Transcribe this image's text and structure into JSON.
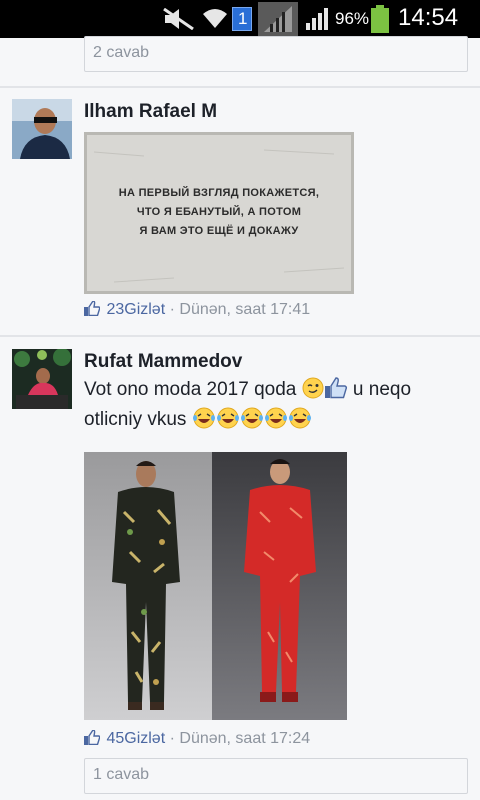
{
  "status_bar": {
    "notification_count": "1",
    "battery": "96%",
    "time": "14:54"
  },
  "top_reply": {
    "label": "2 cavab"
  },
  "comments": [
    {
      "author": "Ilham Rafael M",
      "meme_lines": [
        "НА ПЕРВЫЙ ВЗГЛЯД ПОКАЖЕТСЯ,",
        "ЧТО Я ЕБАНУТЫЙ, А ПОТОМ",
        "Я ВАМ ЭТО ЕЩЁ И ДОКАЖУ"
      ],
      "likes": "23Gizlət",
      "time": "Dünən, saat 17:41"
    },
    {
      "author": "Rufat Mammedov",
      "text_line1": "Vot ono moda 2017 qoda",
      "text_line1_suffix": "u neqo",
      "text_line2": "otlicniy vkus",
      "likes": "45Gizlət",
      "time": "Dünən, saat 17:24",
      "reply_label": "1 cavab"
    }
  ],
  "colors": {
    "link": "#4b67a1",
    "meta": "#8d949e",
    "background": "#f6f7f9"
  },
  "icons": [
    "mute-icon",
    "wifi-icon",
    "notification-badge",
    "signal-icon",
    "battery-icon",
    "thumbs-up-icon",
    "wink-emoji",
    "laughing-emoji"
  ]
}
